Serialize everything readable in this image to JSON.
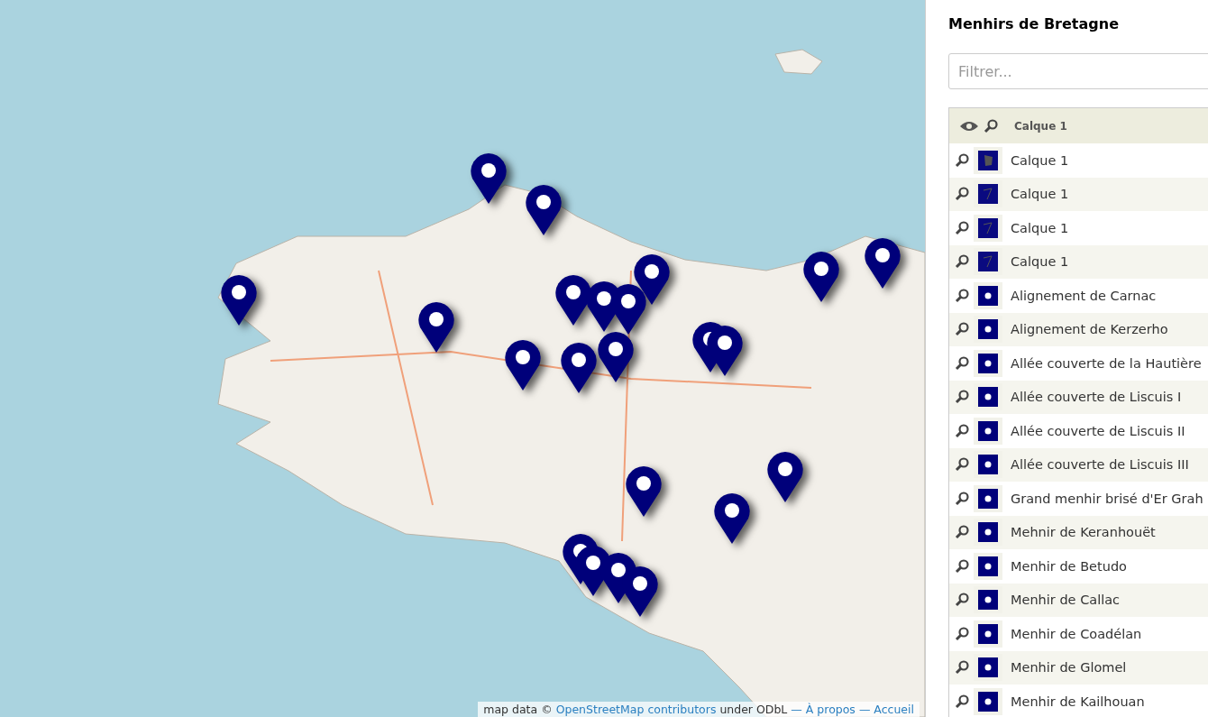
{
  "panel": {
    "title": "Menhirs de Bretagne",
    "filter": {
      "placeholder": "Filtrer..."
    },
    "layer": {
      "name": "Calque 1"
    },
    "features": [
      {
        "kind": "polygon",
        "name": "Calque 1"
      },
      {
        "kind": "line",
        "name": "Calque 1"
      },
      {
        "kind": "line",
        "name": "Calque 1"
      },
      {
        "kind": "line",
        "name": "Calque 1"
      },
      {
        "kind": "point",
        "name": "Alignement de Carnac"
      },
      {
        "kind": "point",
        "name": "Alignement de Kerzerho"
      },
      {
        "kind": "point",
        "name": "Allée couverte de la Hautière"
      },
      {
        "kind": "point",
        "name": "Allée couverte de Liscuis I"
      },
      {
        "kind": "point",
        "name": "Allée couverte de Liscuis II"
      },
      {
        "kind": "point",
        "name": "Allée couverte de Liscuis III"
      },
      {
        "kind": "point",
        "name": "Grand menhir brisé d'Er Grah"
      },
      {
        "kind": "point",
        "name": "Mehnir de Keranhouët"
      },
      {
        "kind": "point",
        "name": "Menhir de Betudo"
      },
      {
        "kind": "point",
        "name": "Menhir de Callac"
      },
      {
        "kind": "point",
        "name": "Menhir de Coadélan"
      },
      {
        "kind": "point",
        "name": "Menhir de Glomel"
      },
      {
        "kind": "point",
        "name": "Menhir de Kailhouan"
      }
    ]
  },
  "attribution": {
    "prefix": "map data ©",
    "osm_link": "OpenStreetMap contributors",
    "license": "under ODbL",
    "about_link": "— À propos",
    "home_link": "— Accueil"
  }
}
